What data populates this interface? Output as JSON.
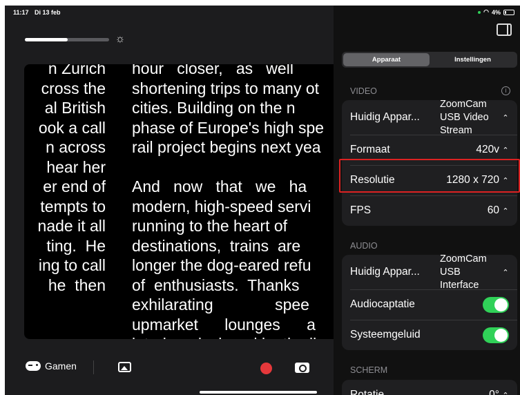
{
  "status": {
    "time": "11:17",
    "date": "Di 13 feb",
    "battery": "4%"
  },
  "camera_text": {
    "left_col": "n Zurich\ncross the\nal British\nook a call\nn across\nhear her\ner end of\ntempts to\nnade it all\nting.  He\ning to call\nhe  then",
    "right_col": "hour   closer,   as   well\nshortening trips to many ot\ncities. Building on the n\nphase of Europe's high spe\nrail project begins next yea\n\nAnd   now   that   we   ha\nmodern, high-speed servi\nrunning to the heart of\ndestinations,  trains  are\nlonger the dog-eared refu\nof  enthusiasts.  Thanks\nexhilarating              spee\nupmarket      lounges      a\ninteriors designed by the li"
  },
  "bottom_bar": {
    "gamen_label": "Gamen"
  },
  "panel": {
    "tabs": [
      {
        "label": "Apparaat",
        "active": true
      },
      {
        "label": "Instellingen",
        "active": false
      }
    ],
    "video": {
      "section_label": "VIDEO",
      "rows": [
        {
          "label": "Huidig Appar...",
          "value": "ZoomCam\nUSB Video\nStream"
        },
        {
          "label": "Formaat",
          "value": "420v"
        },
        {
          "label": "Resolutie",
          "value": "1280 x 720"
        },
        {
          "label": "FPS",
          "value": "60"
        }
      ]
    },
    "audio": {
      "section_label": "AUDIO",
      "rows": [
        {
          "label": "Huidig Appar...",
          "value": "ZoomCam\nUSB\nInterface"
        },
        {
          "label": "Audiocaptatie",
          "toggle": true
        },
        {
          "label": "Systeemgeluid",
          "toggle": true
        }
      ]
    },
    "screen": {
      "section_label": "SCHERM",
      "rows": [
        {
          "label": "Rotatie",
          "value": "0°"
        }
      ]
    }
  },
  "colors": {
    "accent_green": "#30d158",
    "record_red": "#e5383b",
    "highlight": "#dd2222"
  }
}
